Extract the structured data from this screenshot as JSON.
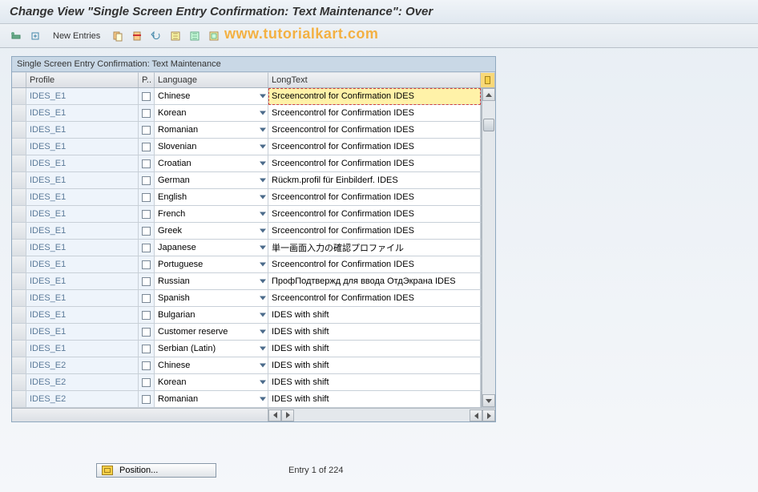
{
  "title": "Change View \"Single Screen Entry Confirmation: Text Maintenance\": Over",
  "watermark": "www.tutorialkart.com",
  "toolbar": {
    "new_entries": "New Entries"
  },
  "panel": {
    "title": "Single Screen Entry Confirmation: Text Maintenance"
  },
  "columns": {
    "profile": "Profile",
    "p": "P..",
    "language": "Language",
    "longtext": "LongText"
  },
  "rows": [
    {
      "profile": "IDES_E1",
      "language": "Chinese",
      "longtext": "Srceencontrol for Confirmation   IDES",
      "selected": true
    },
    {
      "profile": "IDES_E1",
      "language": "Korean",
      "longtext": "Srceencontrol for Confirmation   IDES"
    },
    {
      "profile": "IDES_E1",
      "language": "Romanian",
      "longtext": "Srceencontrol for Confirmation   IDES"
    },
    {
      "profile": "IDES_E1",
      "language": "Slovenian",
      "longtext": "Srceencontrol for Confirmation   IDES"
    },
    {
      "profile": "IDES_E1",
      "language": "Croatian",
      "longtext": "Srceencontrol for Confirmation   IDES"
    },
    {
      "profile": "IDES_E1",
      "language": "German",
      "longtext": "Rückm.profil für Einbilderf.    IDES"
    },
    {
      "profile": "IDES_E1",
      "language": "English",
      "longtext": "Srceencontrol for Confirmation   IDES"
    },
    {
      "profile": "IDES_E1",
      "language": "French",
      "longtext": "Srceencontrol for Confirmation   IDES"
    },
    {
      "profile": "IDES_E1",
      "language": "Greek",
      "longtext": "Srceencontrol for Confirmation   IDES"
    },
    {
      "profile": "IDES_E1",
      "language": "Japanese",
      "longtext": "単一画面入力の確認プロファイル"
    },
    {
      "profile": "IDES_E1",
      "language": "Portuguese",
      "longtext": "Srceencontrol for Confirmation   IDES"
    },
    {
      "profile": "IDES_E1",
      "language": "Russian",
      "longtext": "ПрофПодтвержд для ввода ОтдЭкрана IDES"
    },
    {
      "profile": "IDES_E1",
      "language": "Spanish",
      "longtext": "Srceencontrol for Confirmation   IDES"
    },
    {
      "profile": "IDES_E1",
      "language": "Bulgarian",
      "longtext": "IDES with shift"
    },
    {
      "profile": "IDES_E1",
      "language": "Customer reserve",
      "longtext": "IDES with shift"
    },
    {
      "profile": "IDES_E1",
      "language": "Serbian (Latin)",
      "longtext": "IDES with shift"
    },
    {
      "profile": "IDES_E2",
      "language": "Chinese",
      "longtext": "IDES with shift"
    },
    {
      "profile": "IDES_E2",
      "language": "Korean",
      "longtext": "IDES with shift"
    },
    {
      "profile": "IDES_E2",
      "language": "Romanian",
      "longtext": "IDES with shift"
    }
  ],
  "footer": {
    "position_label": "Position...",
    "entry_text": "Entry 1 of 224"
  }
}
